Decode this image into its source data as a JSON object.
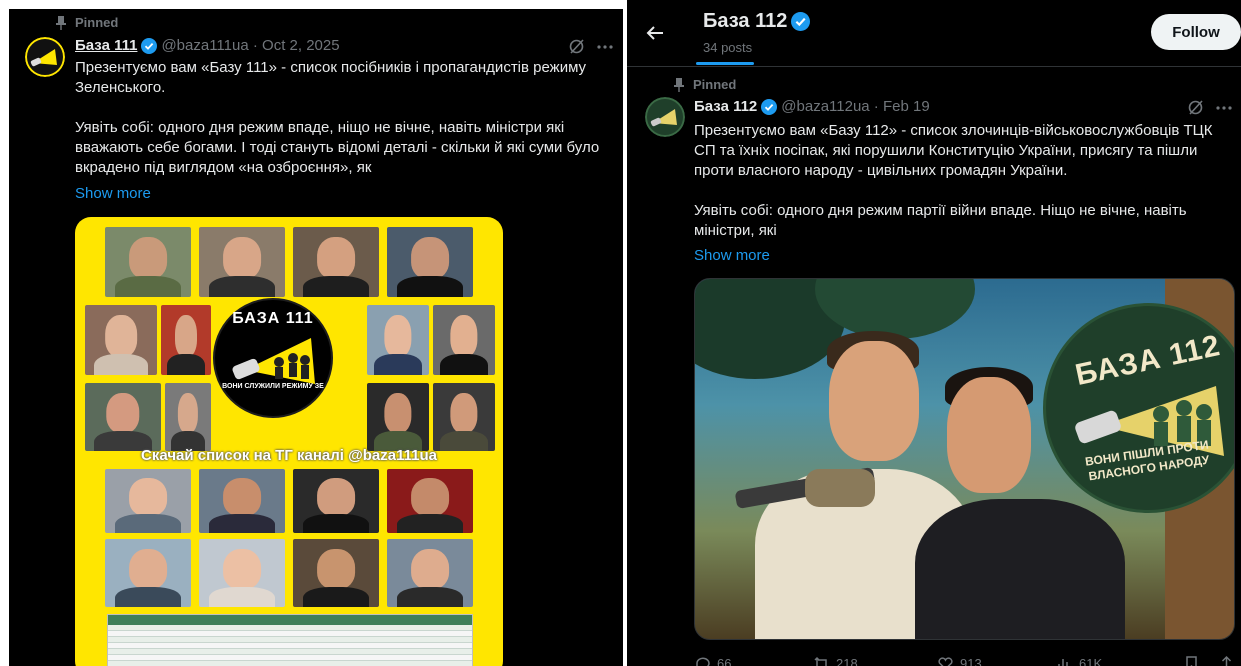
{
  "left_tweet": {
    "pinned_label": "Pinned",
    "author_name": "База 111",
    "handle_date": "@baza111ua · Oct 2, 2025",
    "text_line1": "Презентуємо вам «Базу 111» - список посібників і пропагандистів режиму",
    "text_line2": "Зеленського.",
    "text_line3": "Уявіть собі: одного дня режим впаде, ніщо не вічне, навіть міністри які",
    "text_line4": "вважають себе богами. І тоді стануть відомі деталі - скільки й які суми було",
    "text_line5": "вкрадено під виглядом «на озброєння», як",
    "show_more": "Show more",
    "image": {
      "logo_title": "БАЗА 111",
      "logo_subtitle": "ВОНИ СЛУЖИЛИ РЕЖИМУ ЗЕ",
      "banner": "Скачай список на ТГ каналі @baza111ua"
    }
  },
  "right_header": {
    "profile_name": "База 112",
    "post_count": "34 posts",
    "follow_label": "Follow"
  },
  "right_tweet": {
    "pinned_label": "Pinned",
    "author_name": "База 112",
    "handle_date": "@baza112ua · Feb 19",
    "text_line1": "Презентуємо вам «Базу 112» - список злочинців-військовослужбовців ТЦК",
    "text_line2": "СП та їхніх посіпак, які порушили Конституцію України, присягу та пішли",
    "text_line3": "проти власного народу - цивільних громадян України.",
    "text_line4": "Уявіть собі: одного дня режим партії війни впаде. Ніщо не вічне, навіть",
    "text_line5": "міністри, які",
    "show_more": "Show more",
    "image": {
      "logo_title": "БАЗА 112",
      "logo_subtitle": "ВОНИ ПІШЛИ ПРОТИ ВЛАСНОГО НАРОДУ"
    },
    "stats": {
      "replies": "66",
      "reposts": "218",
      "likes": "913",
      "views": "61K"
    }
  },
  "colors": {
    "background": "#000000",
    "text": "#e7e9ea",
    "muted": "#71767b",
    "accent": "#1d9bf0",
    "collage_yellow": "#ffe600"
  },
  "icons": [
    "pin-icon",
    "verified-badge-icon",
    "grok-icon",
    "more-icon",
    "back-arrow-icon",
    "reply-icon",
    "repost-icon",
    "like-icon",
    "views-icon",
    "bookmark-icon",
    "share-icon"
  ]
}
